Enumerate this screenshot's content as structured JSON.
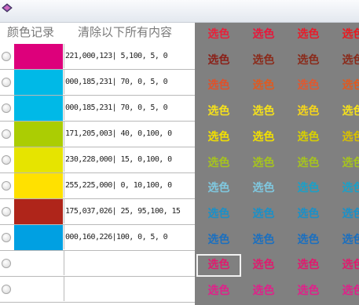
{
  "header": {
    "left": "颜色记录",
    "right": "清除以下所有内容"
  },
  "records": [
    {
      "color": "#dd007b",
      "text": "221,000,123|  5,100,  5,  0"
    },
    {
      "color": "#00b9e7",
      "text": "000,185,231| 70,  0,  5,  0"
    },
    {
      "color": "#00b9e7",
      "text": "000,185,231| 70,  0,  5,  0"
    },
    {
      "color": "#abcd03",
      "text": "171,205,003| 40,  0,100,  0"
    },
    {
      "color": "#e6e400",
      "text": "230,228,000| 15,  0,100,  0"
    },
    {
      "color": "#ffe100",
      "text": "255,225,000|  0, 10,100,  0"
    },
    {
      "color": "#af251a",
      "text": "175,037,026| 25, 95,100, 15"
    },
    {
      "color": "#00a0e2",
      "text": "000,160,226|100,  0,  5,  0"
    },
    {
      "color": "#ffffff",
      "text": ""
    },
    {
      "color": "#ffffff",
      "text": ""
    }
  ],
  "palette": {
    "label": "选色",
    "rows": [
      [
        "#e8203a",
        "#e8163a",
        "#e81c2a",
        "#e81a20"
      ],
      [
        "#8b2018",
        "#8a2a1a",
        "#8a2a1a",
        "#8a2a1a"
      ],
      [
        "#e0502a",
        "#e05a20",
        "#e05830",
        "#e05a20"
      ],
      [
        "#f7e21a",
        "#f7e21a",
        "#f7d61a",
        "#f7e21a"
      ],
      [
        "#f2e000",
        "#f2e000",
        "#d9d000",
        "#d8c000"
      ],
      [
        "#a6c41e",
        "#a6c41e",
        "#a6c41e",
        "#a6c41e"
      ],
      [
        "#7fc8e0",
        "#7fc8e0",
        "#1aa0c8",
        "#1aa0c8"
      ],
      [
        "#1a90c8",
        "#1a90c8",
        "#1a90c8",
        "#1a90c8"
      ],
      [
        "#1a6fc0",
        "#1a6fc0",
        "#1a6fc0",
        "#1a6fc0"
      ],
      [
        "#e01a6e",
        "#e01a6e",
        "#e01a6e",
        "#e01a6e"
      ],
      [
        "#e0208a",
        "#e0208a",
        "#e0208a",
        "#e0208a"
      ]
    ]
  }
}
